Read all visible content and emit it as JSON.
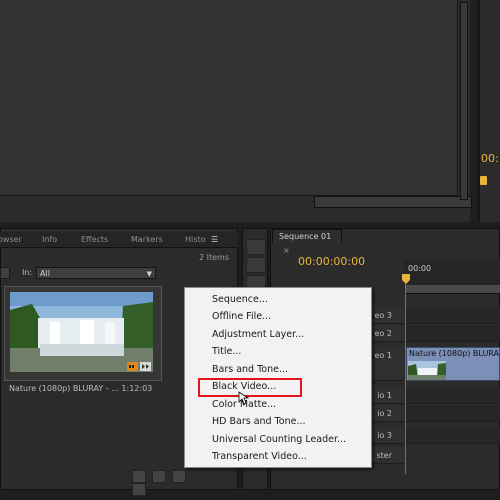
{
  "project_panel": {
    "tabs": [
      "owser",
      "Info",
      "Effects",
      "Markers",
      "Histo"
    ],
    "items_count": "2 Items",
    "in_label": "In:",
    "in_value": "All",
    "clip_caption": "Nature (1080p) BLURAY - ... 1:12:03"
  },
  "program_monitor": {
    "timecode": "00:"
  },
  "sequence": {
    "tab_label": "Sequence 01",
    "timecode": "00:00:00:00",
    "ruler_label": "00:00",
    "tracks": [
      "eo 3",
      "eo 2",
      "eo 1",
      "io 1",
      "io 2",
      "io 3",
      "ster"
    ],
    "clip_label": "Nature (1080p) BLURA"
  },
  "new_item_menu": {
    "items": [
      "Sequence...",
      "Offline File...",
      "Adjustment Layer...",
      "Title...",
      "Bars and Tone...",
      "Black Video...",
      "Color Matte...",
      "HD Bars and Tone...",
      "Universal Counting Leader...",
      "Transparent Video..."
    ],
    "highlighted": "Black Video..."
  },
  "colors": {
    "timecode": "#e8b53b",
    "highlight_box": "#e0141a",
    "clip": "#7b8fb7",
    "playhead": "#d94b3c"
  }
}
